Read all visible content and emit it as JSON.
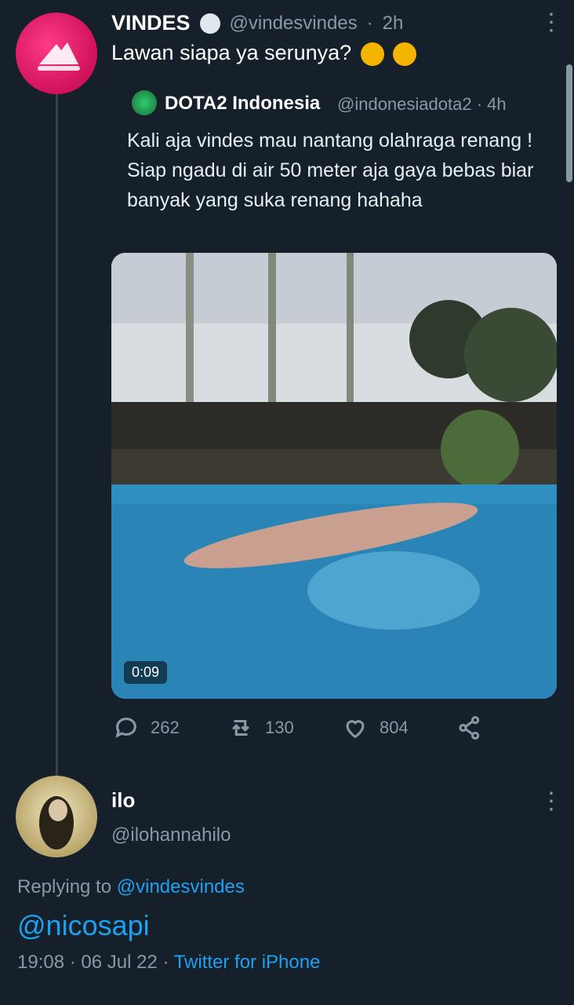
{
  "colors": {
    "background": "#15202b",
    "text_muted": "#8899a6",
    "link": "#1da1f2",
    "avatar_pink": "#d0125a"
  },
  "main_tweet": {
    "author_name": "VINDES",
    "handle": "@vindesvindes",
    "time": "2h",
    "text": "Lawan siapa ya serunya?",
    "more_icon": "more-icon",
    "verified_icon": "verified-icon"
  },
  "quoted_tweet": {
    "author_name": "DOTA2 Indonesia",
    "handle": "@indonesiadota2",
    "time": "4h",
    "text": "Kali aja vindes mau nantang olahraga renang ! Siap ngadu di air 50 meter aja gaya bebas biar banyak yang suka renang hahaha",
    "video_duration": "0:09"
  },
  "actions": {
    "reply_count": "262",
    "retweet_count": "130",
    "like_count": "804",
    "reply_icon": "reply-icon",
    "retweet_icon": "retweet-icon",
    "like_icon": "like-icon",
    "share_icon": "share-icon"
  },
  "reply_tweet": {
    "author_name": "ilo",
    "handle": "@ilohannahilo",
    "replying_label": "Replying to",
    "replying_handle": "@vindesvindes",
    "text": "@nicosapi",
    "timestamp": "19:08 · 06 Jul 22 ·",
    "client": "Twitter for iPhone"
  }
}
